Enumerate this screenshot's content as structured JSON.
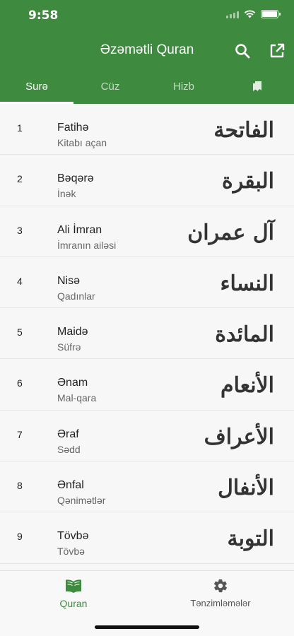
{
  "status": {
    "time": "9:58"
  },
  "header": {
    "title": "Əzəmətli Quran"
  },
  "tabs": [
    {
      "label": "Surə",
      "active": true
    },
    {
      "label": "Cüz",
      "active": false
    },
    {
      "label": "Hizb",
      "active": false
    },
    {
      "label": "",
      "icon": "bookmarks-icon",
      "active": false
    }
  ],
  "surahs": [
    {
      "number": "1",
      "name": "Fatihə",
      "meaning": "Kitabı açan",
      "arabic": "الفاتحة"
    },
    {
      "number": "2",
      "name": "Bəqərə",
      "meaning": "İnək",
      "arabic": "البقرة"
    },
    {
      "number": "3",
      "name": "Ali İmran",
      "meaning": "İmranın ailəsi",
      "arabic": "آل عمران"
    },
    {
      "number": "4",
      "name": "Nisə",
      "meaning": "Qadınlar",
      "arabic": "النساء"
    },
    {
      "number": "5",
      "name": "Maidə",
      "meaning": "Süfrə",
      "arabic": "المائدة"
    },
    {
      "number": "6",
      "name": "Ənam",
      "meaning": "Mal-qara",
      "arabic": "الأنعام"
    },
    {
      "number": "7",
      "name": "Əraf",
      "meaning": "Sədd",
      "arabic": "الأعراف"
    },
    {
      "number": "8",
      "name": "Ənfal",
      "meaning": "Qənimətlər",
      "arabic": "الأنفال"
    },
    {
      "number": "9",
      "name": "Tövbə",
      "meaning": "Tövbə",
      "arabic": "التوبة"
    }
  ],
  "bottom_nav": [
    {
      "label": "Quran",
      "icon": "book-icon",
      "active": true
    },
    {
      "label": "Tənzimləmələr",
      "icon": "gear-icon",
      "active": false
    }
  ],
  "colors": {
    "primary": "#3e8a3e"
  }
}
